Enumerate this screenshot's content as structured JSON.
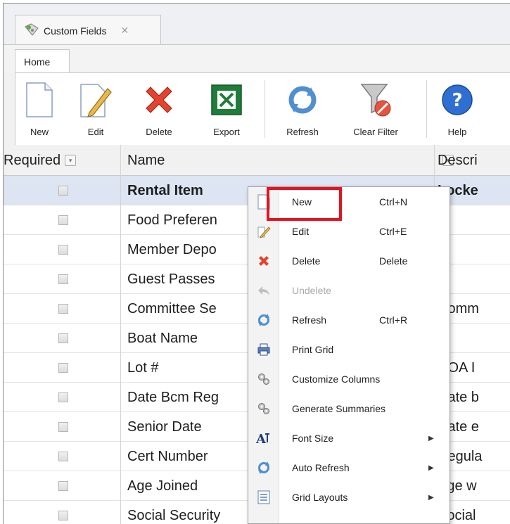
{
  "doc_tab": {
    "title": "Custom Fields",
    "close": "✕"
  },
  "ribbon": {
    "tab": "Home",
    "buttons": {
      "new": "New",
      "edit": "Edit",
      "delete": "Delete",
      "export": "Export",
      "refresh": "Refresh",
      "clear_filter": "Clear Filter",
      "help": "Help"
    }
  },
  "grid": {
    "columns": {
      "required": "Required",
      "name": "Name",
      "description": "Descri"
    },
    "rows": [
      {
        "name": "Rental Item",
        "description": "Locke",
        "required": false,
        "selected": true
      },
      {
        "name": "Food Preferen",
        "description": "",
        "required": false
      },
      {
        "name": "Member Depo",
        "description": "",
        "required": false
      },
      {
        "name": "Guest Passes",
        "description": "",
        "required": false
      },
      {
        "name": "Committee Se",
        "description": "Comm",
        "required": false
      },
      {
        "name": "Boat Name",
        "description": "",
        "required": false
      },
      {
        "name": "Lot #",
        "description": "HOA I",
        "required": false
      },
      {
        "name": "Date Bcm Reg",
        "description": "Date b",
        "required": false
      },
      {
        "name": "Senior Date",
        "description": "Date e",
        "required": false
      },
      {
        "name": "Cert Number",
        "description": "Regula",
        "required": false
      },
      {
        "name": "Age Joined",
        "description": "Age w",
        "required": false
      },
      {
        "name": "Social Security",
        "description": "Social",
        "required": false
      }
    ]
  },
  "context_menu": {
    "items": [
      {
        "label": "New",
        "shortcut": "Ctrl+N",
        "icon": "new-document-icon",
        "highlighted": true
      },
      {
        "label": "Edit",
        "shortcut": "Ctrl+E",
        "icon": "edit-pencil-icon"
      },
      {
        "label": "Delete",
        "shortcut": "Delete",
        "icon": "delete-x-icon"
      },
      {
        "label": "Undelete",
        "shortcut": "",
        "icon": "undo-arrow-icon",
        "disabled": true
      },
      {
        "label": "Refresh",
        "shortcut": "Ctrl+R",
        "icon": "refresh-icon"
      },
      {
        "label": "Print Grid",
        "shortcut": "",
        "icon": "printer-icon"
      },
      {
        "label": "Customize Columns",
        "shortcut": "",
        "icon": "gears-icon"
      },
      {
        "label": "Generate Summaries",
        "shortcut": "",
        "icon": "gears-icon"
      },
      {
        "label": "Font Size",
        "shortcut": "",
        "icon": "font-size-icon",
        "submenu": true
      },
      {
        "label": "Auto Refresh",
        "shortcut": "",
        "icon": "refresh-icon",
        "submenu": true
      },
      {
        "label": "Grid Layouts",
        "shortcut": "",
        "icon": "layout-list-icon",
        "submenu": true
      }
    ]
  },
  "colors": {
    "highlight_border": "#e3141f",
    "selected_row": "#dde4f2"
  }
}
